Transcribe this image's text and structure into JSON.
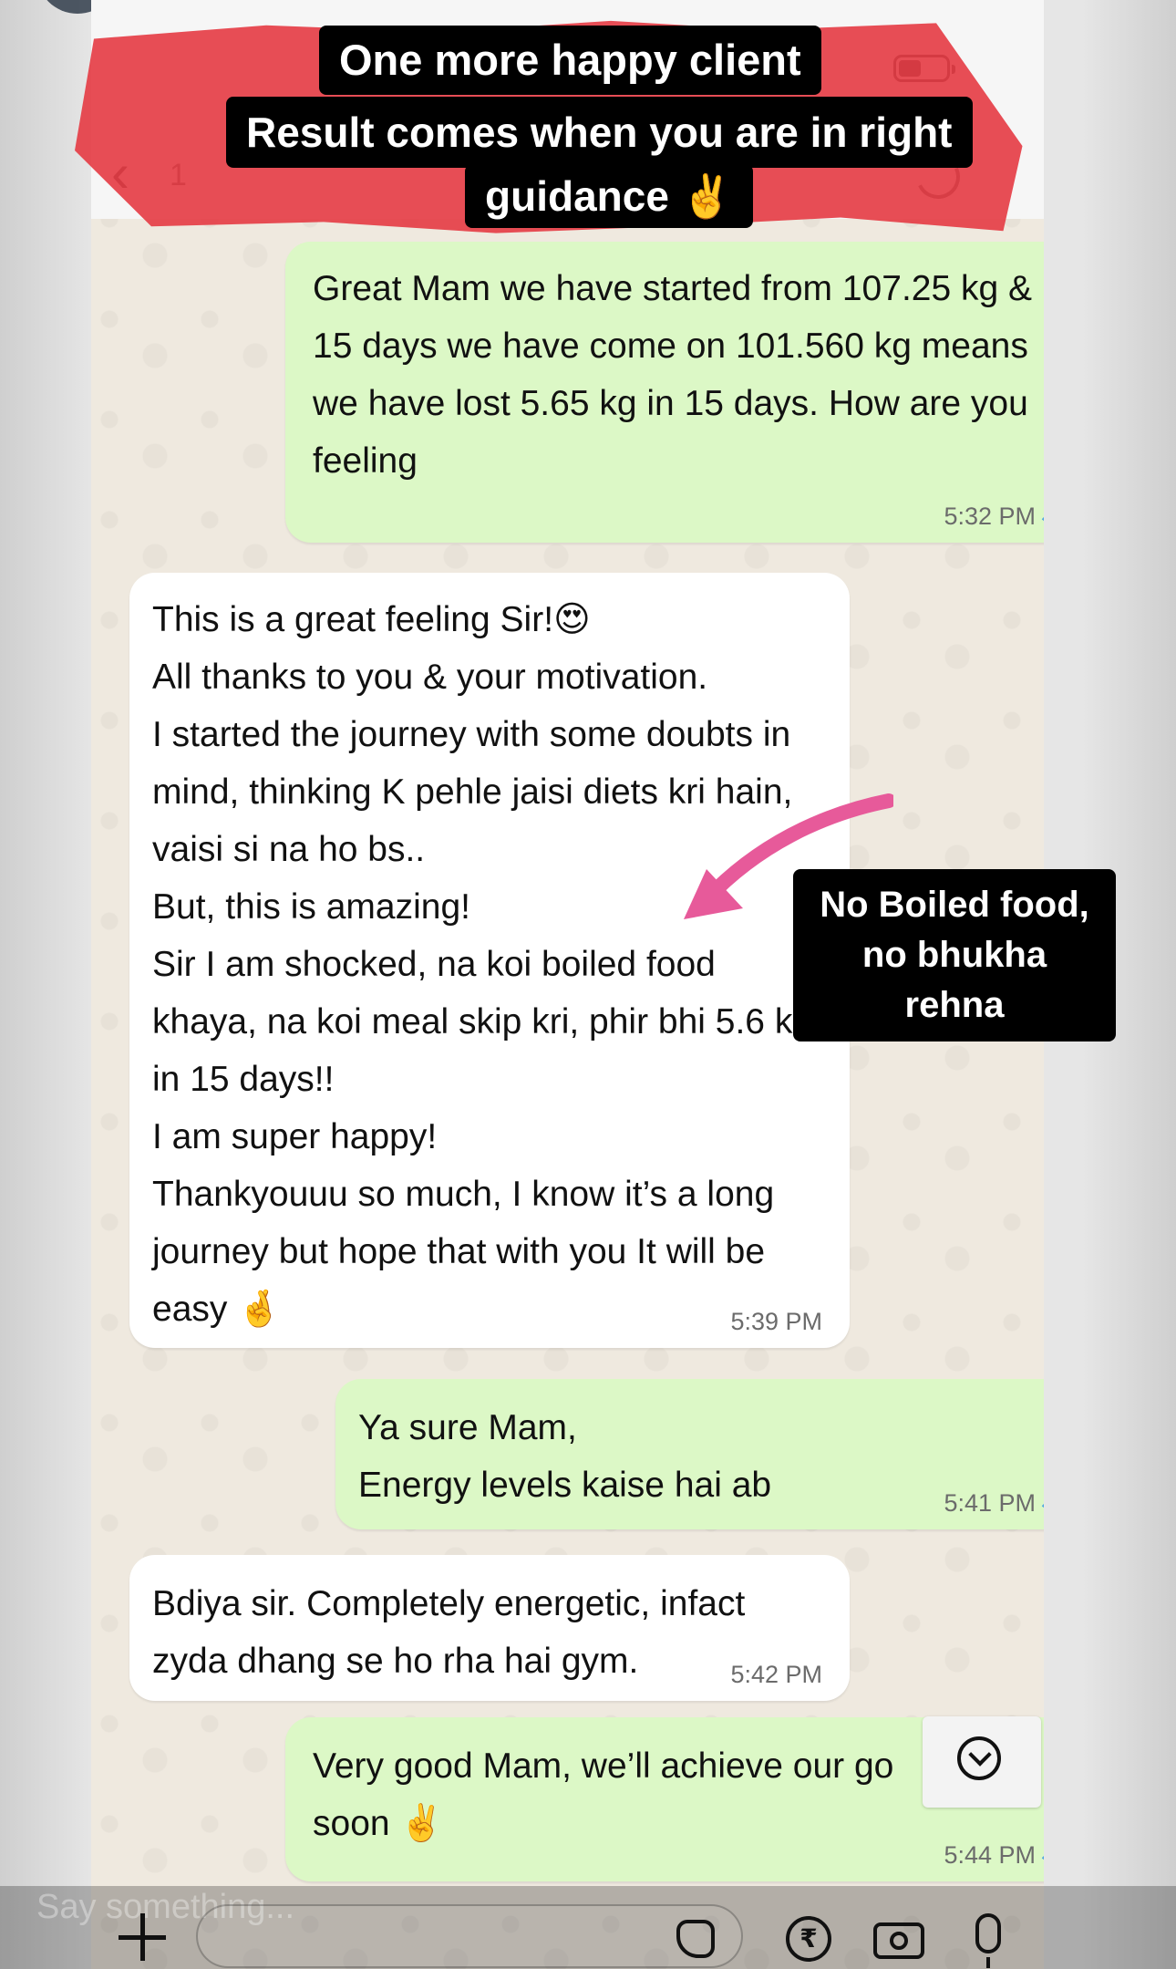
{
  "overlay": {
    "caption_line_1": "One more happy client",
    "caption_line_2": "Result comes when you are in right",
    "caption_line_3": "guidance ✌️",
    "side_note": "No Boiled food, no bhukha rehna"
  },
  "header": {
    "back_count": "1"
  },
  "messages": [
    {
      "direction": "outgoing",
      "text": "Great Mam we have started from 107.25 kg & in 15 days we have come on 101.560 kg means we have lost 5.65 kg in 15 days. How are you feeling",
      "time": "5:32 PM",
      "read": true
    },
    {
      "direction": "incoming",
      "text": "This is a great feeling Sir!😍\nAll thanks to you & your motivation.\nI started the journey with some doubts in mind, thinking K pehle jaisi diets kri hain, vaisi si na ho bs..\nBut, this is amazing!\nSir I am shocked, na koi boiled food khaya, na koi meal skip kri, phir bhi 5.6 kg in 15 days!!\nI am super happy!\nThankyouuu so much, I know it’s a long journey but hope that with you It will be easy 🤞",
      "time": "5:39 PM"
    },
    {
      "direction": "outgoing",
      "text": "Ya sure Mam,\nEnergy levels kaise hai ab",
      "time": "5:41 PM",
      "read": true
    },
    {
      "direction": "incoming",
      "text": "Bdiya sir. Completely energetic, infact zyda dhang se ho rha hai gym.",
      "time": "5:42 PM"
    },
    {
      "direction": "outgoing",
      "text": "Very good Mam, we’ll achieve our go\nsoon ✌️",
      "time": "5:44 PM",
      "read": true
    }
  ],
  "story_input": {
    "placeholder": "Say something..."
  },
  "icons": {
    "back": "chevron-left-icon",
    "battery": "battery-icon",
    "scroll": "chevron-down-circle-icon",
    "add": "plus-icon",
    "sticker": "sticker-icon",
    "payment": "rupee-icon",
    "camera": "camera-icon",
    "mic": "microphone-icon"
  },
  "colors": {
    "outgoing_bubble": "#dcf8c6",
    "incoming_bubble": "#ffffff",
    "read_tick": "#4fa6e0",
    "brush": "#e53e46",
    "arrow": "#e75a9a"
  }
}
